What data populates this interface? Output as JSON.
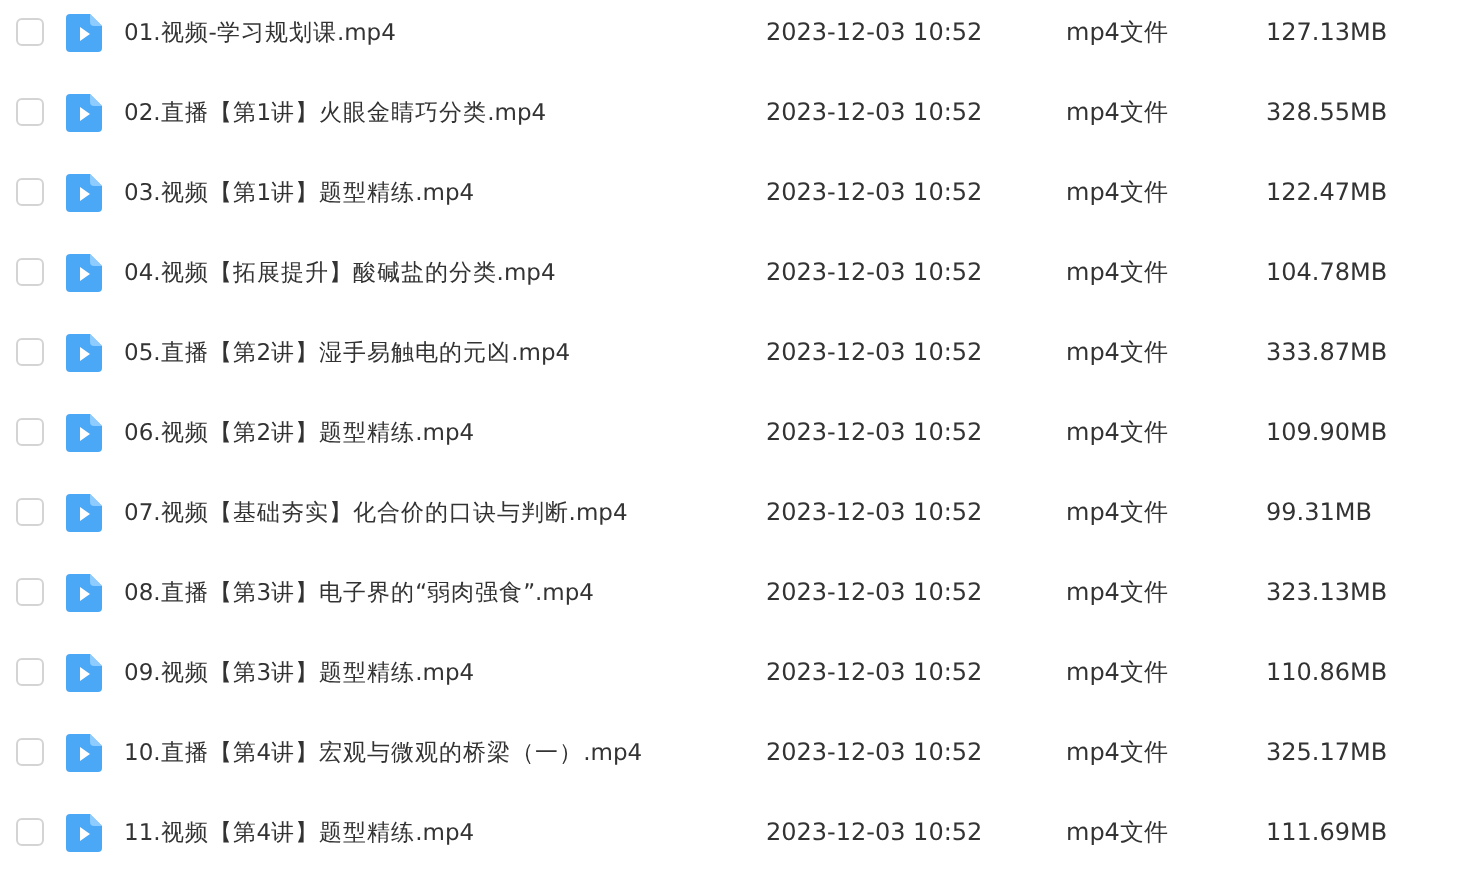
{
  "files": [
    {
      "name": "01.视频-学习规划课.mp4",
      "date": "2023-12-03 10:52",
      "type": "mp4文件",
      "size": "127.13MB",
      "checked": false
    },
    {
      "name": "02.直播【第1讲】火眼金睛巧分类.mp4",
      "date": "2023-12-03 10:52",
      "type": "mp4文件",
      "size": "328.55MB",
      "checked": false
    },
    {
      "name": "03.视频【第1讲】题型精练.mp4",
      "date": "2023-12-03 10:52",
      "type": "mp4文件",
      "size": "122.47MB",
      "checked": false
    },
    {
      "name": "04.视频【拓展提升】酸碱盐的分类.mp4",
      "date": "2023-12-03 10:52",
      "type": "mp4文件",
      "size": "104.78MB",
      "checked": false
    },
    {
      "name": "05.直播【第2讲】湿手易触电的元凶.mp4",
      "date": "2023-12-03 10:52",
      "type": "mp4文件",
      "size": "333.87MB",
      "checked": false
    },
    {
      "name": "06.视频【第2讲】题型精练.mp4",
      "date": "2023-12-03 10:52",
      "type": "mp4文件",
      "size": "109.90MB",
      "checked": false
    },
    {
      "name": "07.视频【基础夯实】化合价的口诀与判断.mp4",
      "date": "2023-12-03 10:52",
      "type": "mp4文件",
      "size": "99.31MB",
      "checked": false
    },
    {
      "name": "08.直播【第3讲】电子界的“弱肉强食”.mp4",
      "date": "2023-12-03 10:52",
      "type": "mp4文件",
      "size": "323.13MB",
      "checked": false
    },
    {
      "name": "09.视频【第3讲】题型精练.mp4",
      "date": "2023-12-03 10:52",
      "type": "mp4文件",
      "size": "110.86MB",
      "checked": false
    },
    {
      "name": "10.直播【第4讲】宏观与微观的桥梁（一）.mp4",
      "date": "2023-12-03 10:52",
      "type": "mp4文件",
      "size": "325.17MB",
      "checked": false
    },
    {
      "name": "11.视频【第4讲】题型精练.mp4",
      "date": "2023-12-03 10:52",
      "type": "mp4文件",
      "size": "111.69MB",
      "checked": false
    }
  ]
}
